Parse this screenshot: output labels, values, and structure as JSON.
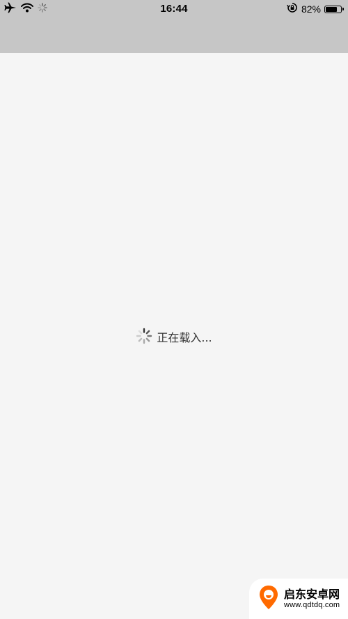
{
  "status_bar": {
    "time": "16:44",
    "battery_percent": "82%",
    "battery_level": 0.82,
    "icons": [
      "airplane-icon",
      "wifi-icon",
      "activity-spinner-icon",
      "rotation-lock-icon",
      "battery-icon"
    ]
  },
  "loading": {
    "text": "正在载入..."
  },
  "watermark": {
    "name": "启东安卓网",
    "url": "www.qdtdq.com",
    "accent_color": "#ff6a00"
  },
  "colors": {
    "status_bar_bg": "#c6c6c6",
    "page_bg": "#f5f5f5"
  }
}
